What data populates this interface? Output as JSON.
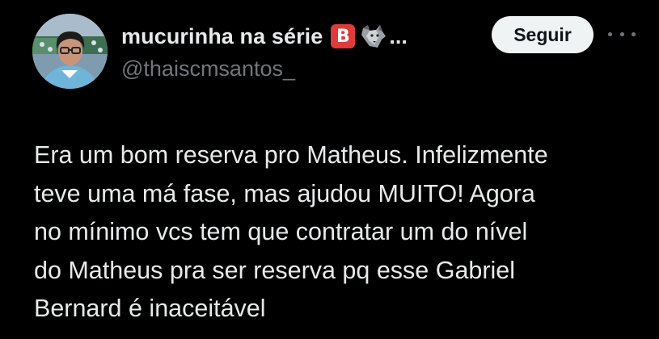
{
  "author": {
    "display_name": "mucurinha na série",
    "badge_letter": "B",
    "badge_color": "#e03b3b",
    "emoji_icon": "wolf-icon",
    "truncation": "...",
    "handle": "@thaiscmsantos_",
    "avatar": "profile-photo"
  },
  "actions": {
    "follow_label": "Seguir",
    "more_icon": "more-horizontal-icon"
  },
  "tweet": {
    "lines": [
      "Era um bom reserva pro Matheus. Infelizmente",
      "teve uma má fase, mas ajudou MUITO! Agora",
      "no mínimo vcs tem que contratar um do nível",
      "do Matheus pra ser reserva pq esse Gabriel",
      "Bernard é inaceitável"
    ]
  },
  "colors": {
    "background": "#000000",
    "primary_text": "#e7e9ea",
    "secondary_text": "#71767b",
    "follow_button_bg": "#eff3f4",
    "follow_button_text": "#0f1419"
  }
}
